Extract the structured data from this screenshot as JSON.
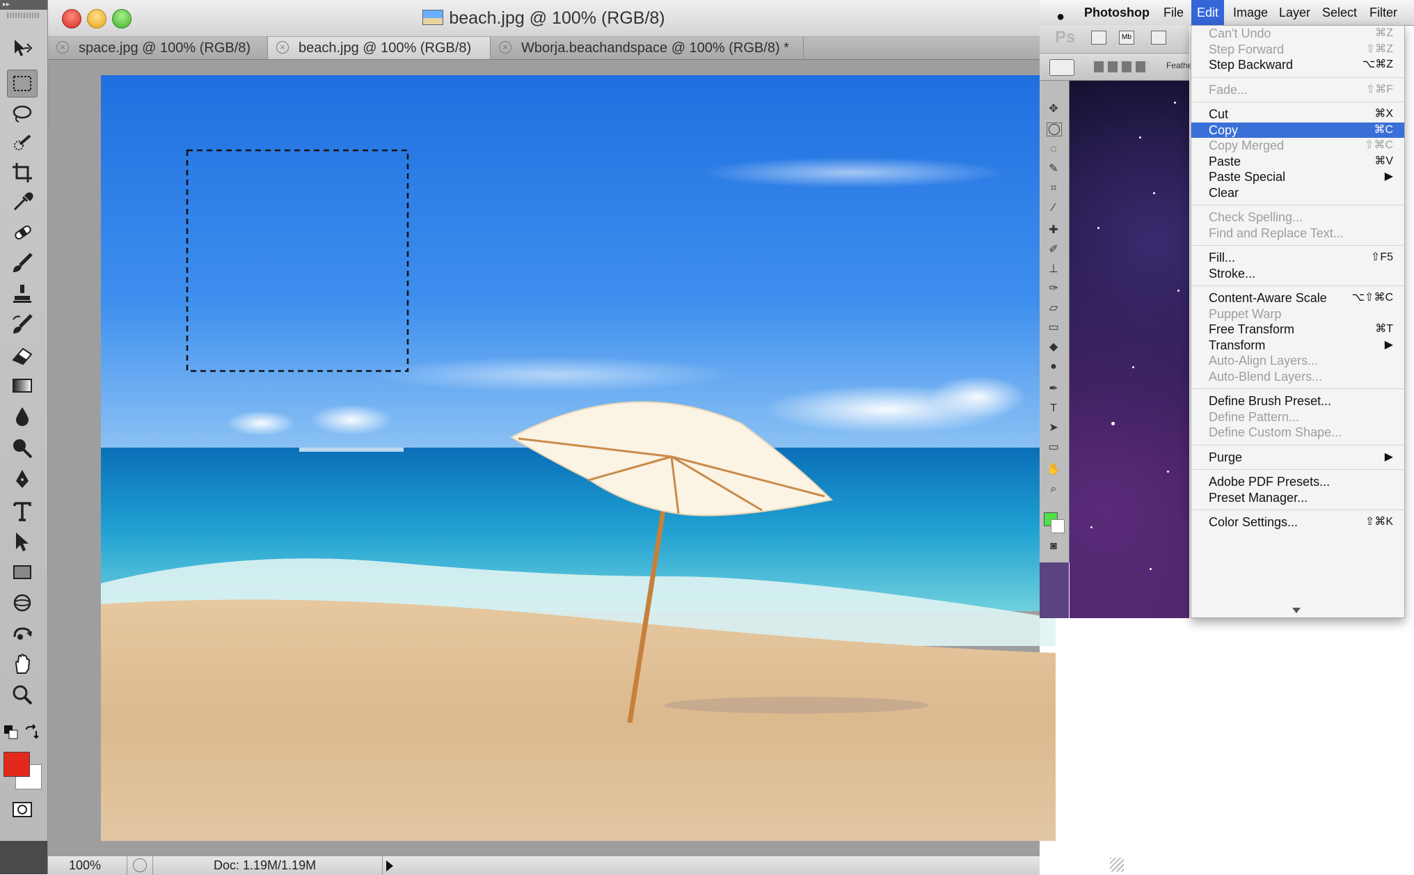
{
  "document": {
    "title": "beach.jpg @ 100% (RGB/8)",
    "tabs": [
      {
        "label": "space.jpg @ 100% (RGB/8)",
        "active": false
      },
      {
        "label": "beach.jpg @ 100% (RGB/8)",
        "active": true
      },
      {
        "label": "Wborja.beachandspace @ 100% (RGB/8) *",
        "active": false
      }
    ],
    "close_glyph": "×"
  },
  "status": {
    "zoom": "100%",
    "doc_info": "Doc: 1.19M/1.19M"
  },
  "tools": [
    {
      "name": "move-tool-icon"
    },
    {
      "name": "rectangular-marquee-tool-icon",
      "active": true
    },
    {
      "name": "lasso-tool-icon"
    },
    {
      "name": "quick-selection-tool-icon"
    },
    {
      "name": "crop-tool-icon"
    },
    {
      "name": "eyedropper-tool-icon"
    },
    {
      "name": "spot-healing-brush-tool-icon"
    },
    {
      "name": "brush-tool-icon"
    },
    {
      "name": "clone-stamp-tool-icon"
    },
    {
      "name": "history-brush-tool-icon"
    },
    {
      "name": "eraser-tool-icon"
    },
    {
      "name": "gradient-tool-icon"
    },
    {
      "name": "blur-tool-icon"
    },
    {
      "name": "dodge-tool-icon"
    },
    {
      "name": "pen-tool-icon"
    },
    {
      "name": "type-tool-icon"
    },
    {
      "name": "path-selection-tool-icon"
    },
    {
      "name": "rectangle-tool-icon"
    },
    {
      "name": "3d-rotate-tool-icon"
    },
    {
      "name": "3d-orbit-tool-icon"
    },
    {
      "name": "hand-tool-icon"
    },
    {
      "name": "zoom-tool-icon"
    }
  ],
  "colors": {
    "foreground": "#e3281c",
    "background": "#ffffff",
    "menu_highlight": "#3a6fd8"
  },
  "menubar": {
    "app": "Photoshop",
    "items": [
      "File",
      "Edit",
      "Image",
      "Layer",
      "Select",
      "Filter"
    ],
    "open": "Edit"
  },
  "appbar": {
    "logo": "Ps",
    "mb": "Mb",
    "feather": "Feathe"
  },
  "edit_menu": [
    {
      "label": "Can't Undo",
      "shortcut": "⌘Z",
      "disabled": true
    },
    {
      "label": "Step Forward",
      "shortcut": "⇧⌘Z",
      "disabled": true
    },
    {
      "label": "Step Backward",
      "shortcut": "⌥⌘Z",
      "disabled": false
    },
    {
      "sep": true
    },
    {
      "label": "Fade...",
      "shortcut": "⇧⌘F",
      "disabled": true
    },
    {
      "sep": true
    },
    {
      "label": "Cut",
      "shortcut": "⌘X",
      "disabled": false
    },
    {
      "label": "Copy",
      "shortcut": "⌘C",
      "disabled": false,
      "highlighted": true
    },
    {
      "label": "Copy Merged",
      "shortcut": "⇧⌘C",
      "disabled": true
    },
    {
      "label": "Paste",
      "shortcut": "⌘V",
      "disabled": false
    },
    {
      "label": "Paste Special",
      "shortcut": "▶",
      "disabled": false
    },
    {
      "label": "Clear",
      "shortcut": "",
      "disabled": false
    },
    {
      "sep": true
    },
    {
      "label": "Check Spelling...",
      "shortcut": "",
      "disabled": true
    },
    {
      "label": "Find and Replace Text...",
      "shortcut": "",
      "disabled": true
    },
    {
      "sep": true
    },
    {
      "label": "Fill...",
      "shortcut": "⇧F5",
      "disabled": false
    },
    {
      "label": "Stroke...",
      "shortcut": "",
      "disabled": false
    },
    {
      "sep": true
    },
    {
      "label": "Content-Aware Scale",
      "shortcut": "⌥⇧⌘C",
      "disabled": false
    },
    {
      "label": "Puppet Warp",
      "shortcut": "",
      "disabled": true
    },
    {
      "label": "Free Transform",
      "shortcut": "⌘T",
      "disabled": false
    },
    {
      "label": "Transform",
      "shortcut": "▶",
      "disabled": false
    },
    {
      "label": "Auto-Align Layers...",
      "shortcut": "",
      "disabled": true
    },
    {
      "label": "Auto-Blend Layers...",
      "shortcut": "",
      "disabled": true
    },
    {
      "sep": true
    },
    {
      "label": "Define Brush Preset...",
      "shortcut": "",
      "disabled": false
    },
    {
      "label": "Define Pattern...",
      "shortcut": "",
      "disabled": true
    },
    {
      "label": "Define Custom Shape...",
      "shortcut": "",
      "disabled": true
    },
    {
      "sep": true
    },
    {
      "label": "Purge",
      "shortcut": "▶",
      "disabled": false
    },
    {
      "sep": true
    },
    {
      "label": "Adobe PDF Presets...",
      "shortcut": "",
      "disabled": false
    },
    {
      "label": "Preset Manager...",
      "shortcut": "",
      "disabled": false
    },
    {
      "sep": true
    },
    {
      "label": "Color Settings...",
      "shortcut": "⇧⌘K",
      "disabled": false
    }
  ]
}
